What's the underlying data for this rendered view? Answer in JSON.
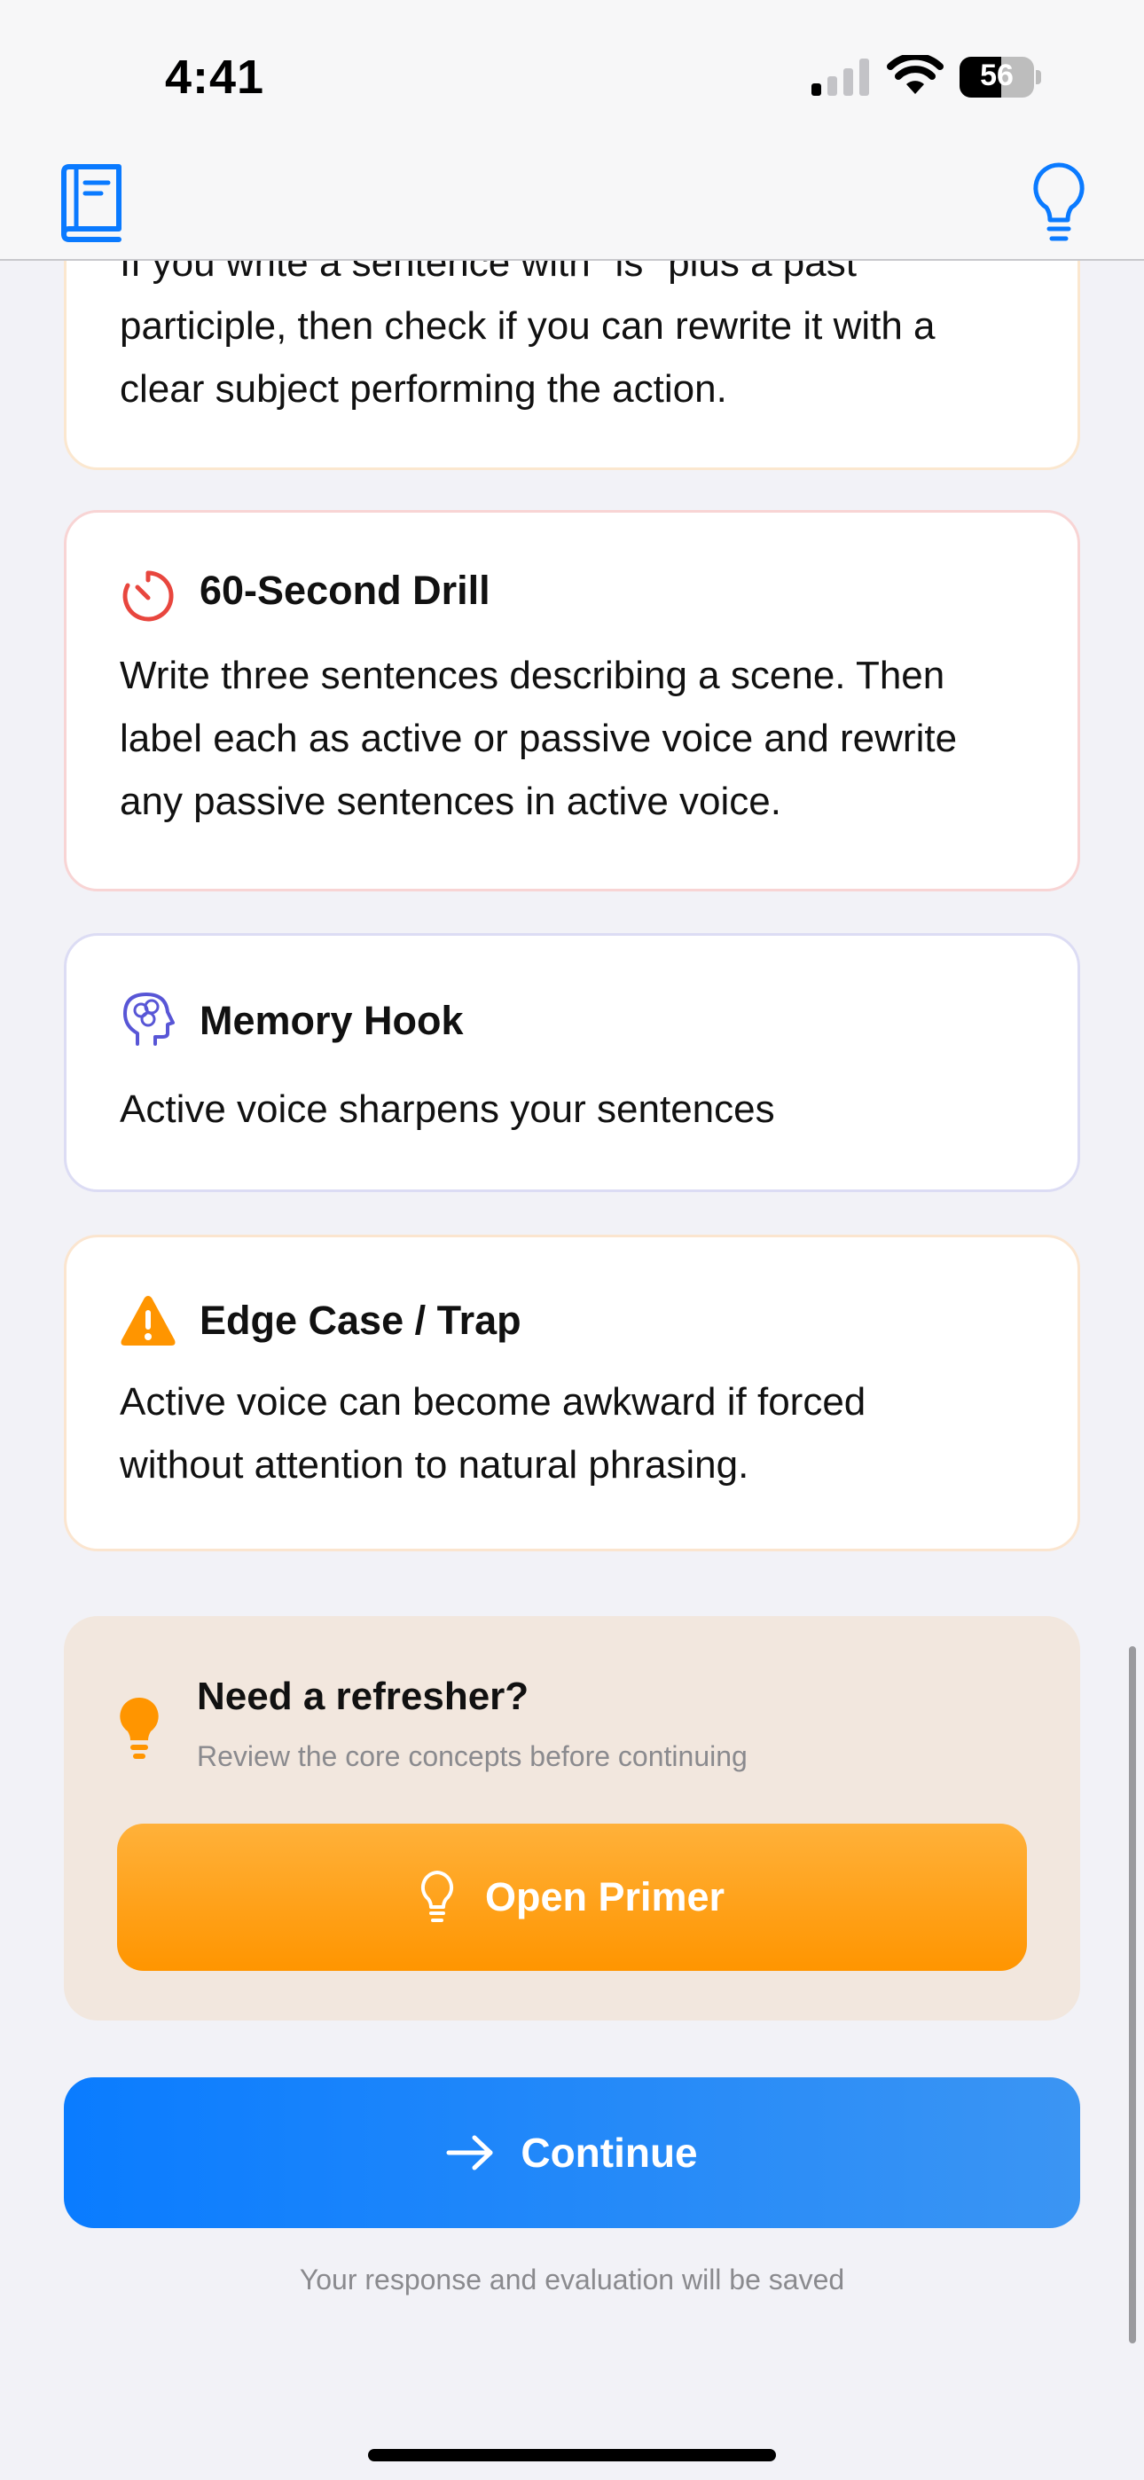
{
  "status_bar": {
    "time": "4:41",
    "battery_percent": "56",
    "battery_level": 0.56,
    "signal_bars_active": 1,
    "signal_bars_total": 4
  },
  "nav": {
    "left_icon": "book-icon",
    "right_icon": "lightbulb-icon",
    "accent_color": "#0a7aff"
  },
  "cards": {
    "partial": {
      "line1": "If you write a sentence with \"is\" plus a past",
      "line2": "participle, then check if you can rewrite it with a",
      "line3": "clear subject performing the action."
    },
    "drill": {
      "title": "60-Second Drill",
      "icon": "timer-icon",
      "color": "#e8463e",
      "line1": "Write three sentences describing a scene. Then",
      "line2": "label each as active or passive voice and rewrite",
      "line3": "any passive sentences in active voice."
    },
    "memory": {
      "title": "Memory Hook",
      "icon": "brain-head-icon",
      "color": "#5856d6",
      "line1": "Active voice sharpens your sentences"
    },
    "edge": {
      "title": "Edge Case / Trap",
      "icon": "warning-icon",
      "color": "#ff9500",
      "line1": "Active voice can become awkward if forced",
      "line2": "without attention to natural phrasing."
    }
  },
  "refresher": {
    "title": "Need a refresher?",
    "subtitle": "Review the core concepts before continuing",
    "button_label": "Open Primer",
    "icon": "lightbulb-icon",
    "color": "#ff9500"
  },
  "footer": {
    "continue_label": "Continue",
    "note": "Your response and evaluation will be saved"
  }
}
